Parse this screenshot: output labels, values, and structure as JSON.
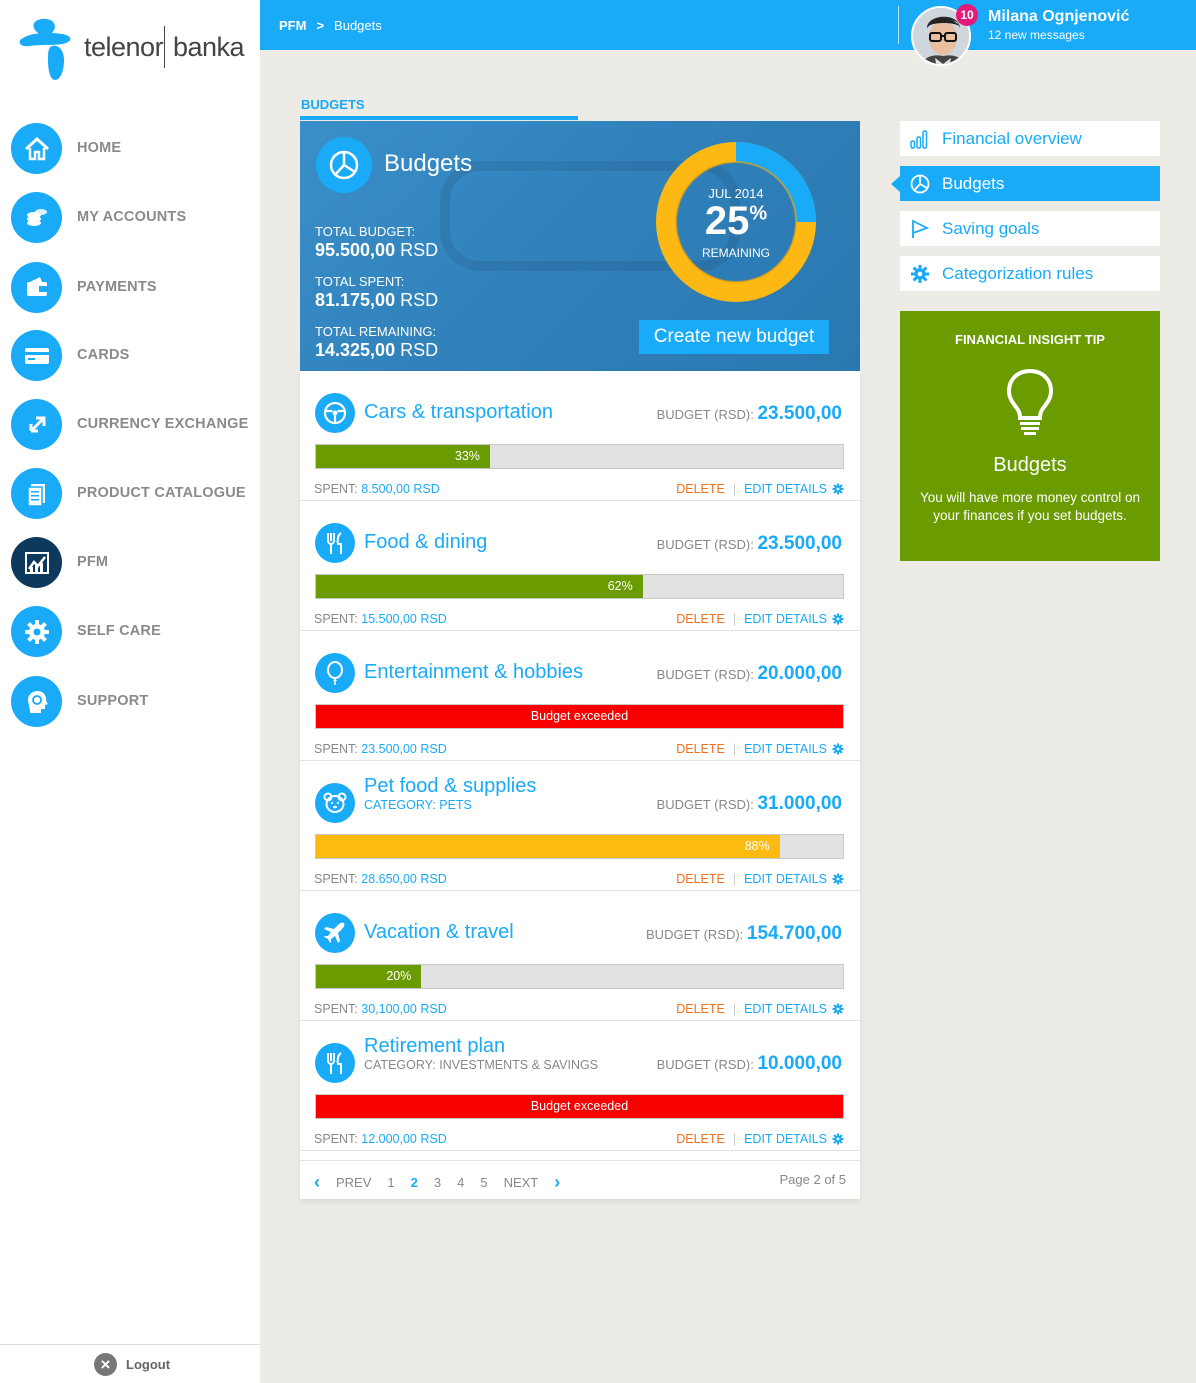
{
  "brand": {
    "part1": "telenor",
    "part2": "banka",
    "accent": "#19aaf8"
  },
  "sidebar": {
    "items": [
      {
        "label": "HOME",
        "icon": "home-icon"
      },
      {
        "label": "MY ACCOUNTS",
        "icon": "coins-icon"
      },
      {
        "label": "PAYMENTS",
        "icon": "wallet-icon"
      },
      {
        "label": "CARDS",
        "icon": "card-icon"
      },
      {
        "label": "CURRENCY EXCHANGE",
        "icon": "exchange-icon"
      },
      {
        "label": "PRODUCT CATALOGUE",
        "icon": "catalogue-icon"
      },
      {
        "label": "PFM",
        "icon": "chart-icon",
        "active": true
      },
      {
        "label": "SELF CARE",
        "icon": "gear-icon"
      },
      {
        "label": "SUPPORT",
        "icon": "support-icon"
      }
    ],
    "logout": "Logout"
  },
  "header": {
    "breadcrumb": [
      "PFM",
      "Budgets"
    ],
    "user_name": "Milana Ognjenović",
    "messages": "12 new messages",
    "badge": "10"
  },
  "main": {
    "section_title": "BUDGETS",
    "hero": {
      "title": "Budgets",
      "total_budget_label": "TOTAL BUDGET:",
      "total_budget_value": "95.500,00",
      "total_spent_label": "TOTAL SPENT:",
      "total_spent_value": "81.175,00",
      "total_remaining_label": "TOTAL REMAINING:",
      "total_remaining_value": "14.325,00",
      "currency": "RSD",
      "month": "JUL 2014",
      "percent": "25",
      "percent_sign": "%",
      "percent_remaining": 25,
      "remaining_label": "REMAINING",
      "create_button": "Create new budget"
    },
    "budget_label": "BUDGET (RSD):",
    "spent_label": "SPENT:",
    "delete_label": "DELETE",
    "edit_label": "EDIT DETAILS",
    "budgets": [
      {
        "name": "Cars & transportation",
        "category": "",
        "icon": "steering-wheel-icon",
        "budget": "23.500,00",
        "spent": "8.500,00 RSD",
        "progress_label": "33%",
        "progress": 33,
        "status": "green"
      },
      {
        "name": "Food & dining",
        "category": "",
        "icon": "fork-knife-icon",
        "budget": "23.500,00",
        "spent": "15.500,00 RSD",
        "progress_label": "62%",
        "progress": 62,
        "status": "green"
      },
      {
        "name": "Entertainment & hobbies",
        "category": "",
        "icon": "balloon-icon",
        "budget": "20.000,00",
        "spent": "23.500,00 RSD",
        "progress_label": "Budget exceeded",
        "progress": 100,
        "status": "red"
      },
      {
        "name": "Pet food & supplies",
        "category": "CATEGORY: PETS",
        "icon": "pet-icon",
        "budget": "31.000,00",
        "spent": "28.650,00 RSD",
        "progress_label": "88%",
        "progress": 88,
        "status": "yellow"
      },
      {
        "name": "Vacation & travel",
        "category": "",
        "icon": "airplane-icon",
        "budget": "154.700,00",
        "spent": "30,100,00 RSD",
        "progress_label": "20%",
        "progress": 20,
        "status": "green"
      },
      {
        "name": "Retirement plan",
        "category": "CATEGORY: INVESTMENTS & SAVINGS",
        "icon": "fork-knife-icon",
        "budget": "10.000,00",
        "spent": "12.000,00 RSD",
        "progress_label": "Budget exceeded",
        "progress": 100,
        "status": "red"
      }
    ],
    "pager": {
      "prev": "PREV",
      "next": "NEXT",
      "pages": [
        "1",
        "2",
        "3",
        "4",
        "5"
      ],
      "current": "2",
      "info": "Page 2 of 5"
    }
  },
  "right": {
    "menu": [
      {
        "label": "Financial overview",
        "icon": "bar-chart-icon"
      },
      {
        "label": "Budgets",
        "icon": "pie-chart-icon",
        "active": true
      },
      {
        "label": "Saving goals",
        "icon": "flag-icon"
      },
      {
        "label": "Categorization rules",
        "icon": "gear-icon"
      }
    ],
    "tip": {
      "heading": "FINANCIAL INSIGHT TIP",
      "title": "Budgets",
      "text": "You will have more money control on your finances if you set budgets.",
      "color": "#6a9b00"
    }
  }
}
